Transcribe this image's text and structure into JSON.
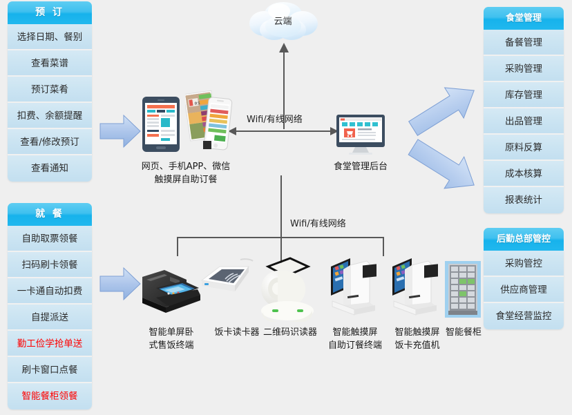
{
  "meta": {
    "title": "智慧食堂系统架构图",
    "background": "#efefef",
    "accent_header": "#16b2ec",
    "accent_item": "#cbe4f2",
    "alert_color": "#ff0000",
    "arrow_fill": "#a8c4ea",
    "line_color": "#585858"
  },
  "panels": {
    "left": [
      {
        "id": "reserve",
        "title": "预 订",
        "items": [
          {
            "label": "选择日期、餐别",
            "highlight": false
          },
          {
            "label": "查看菜谱",
            "highlight": false
          },
          {
            "label": "预订菜肴",
            "highlight": false
          },
          {
            "label": "扣费、余额提醒",
            "highlight": false
          },
          {
            "label": "查看/修改预订",
            "highlight": false
          },
          {
            "label": "查看通知",
            "highlight": false
          }
        ]
      },
      {
        "id": "dining",
        "title": "就 餐",
        "items": [
          {
            "label": "自助取票领餐",
            "highlight": false
          },
          {
            "label": "扫码刷卡领餐",
            "highlight": false
          },
          {
            "label": "一卡通自动扣费",
            "highlight": false
          },
          {
            "label": "自提派送",
            "highlight": false
          },
          {
            "label": "勤工俭学抢单送",
            "highlight": true
          },
          {
            "label": "刷卡窗口点餐",
            "highlight": false
          },
          {
            "label": "智能餐柜领餐",
            "highlight": true
          }
        ]
      }
    ],
    "right": [
      {
        "id": "canteen-management",
        "title": "食堂管理",
        "items": [
          {
            "label": "备餐管理",
            "highlight": false
          },
          {
            "label": "采购管理",
            "highlight": false
          },
          {
            "label": "库存管理",
            "highlight": false
          },
          {
            "label": "出品管理",
            "highlight": false
          },
          {
            "label": "原料反算",
            "highlight": false
          },
          {
            "label": "成本核算",
            "highlight": false
          },
          {
            "label": "报表统计",
            "highlight": false
          }
        ]
      },
      {
        "id": "hq-control",
        "title": "后勤总部管控",
        "items": [
          {
            "label": "采购管控",
            "highlight": false
          },
          {
            "label": "供应商管理",
            "highlight": false
          },
          {
            "label": "食堂经营监控",
            "highlight": false
          }
        ]
      }
    ]
  },
  "cloud": {
    "label": "云端"
  },
  "network_labels": {
    "upper": "Wifi/有线网络",
    "lower": "Wifi/有线网络"
  },
  "captions": {
    "ordering_clients_line1": "网页、手机APP、微信",
    "ordering_clients_line2": "触摸屏自助订餐",
    "backend": "食堂管理后台",
    "pos_terminal_line1": "智能单屏卧",
    "pos_terminal_line2": "式售饭终端",
    "card_reader": "饭卡读卡器",
    "qr_scanner": "二维码识读器",
    "self_order_line1": "智能触摸屏",
    "self_order_line2": "自助订餐终端",
    "recharge_line1": "智能触摸屏",
    "recharge_line2": "饭卡充值机",
    "smart_locker": "智能餐柜"
  },
  "icons": {
    "cloud": "cloud-icon",
    "tablet": "tablet-device-icon",
    "phone": "smartphone-device-icon",
    "monitor": "desktop-monitor-icon",
    "pos": "pos-terminal-icon",
    "nfc_reader": "nfc-card-reader-icon",
    "qr": "qr-scanner-icon",
    "kiosk": "touchscreen-kiosk-icon",
    "locker": "smart-food-locker-icon",
    "arrow_right": "arrow-right-icon",
    "arrow_up_right": "arrow-up-right-icon",
    "arrow_down_right": "arrow-down-right-icon"
  }
}
